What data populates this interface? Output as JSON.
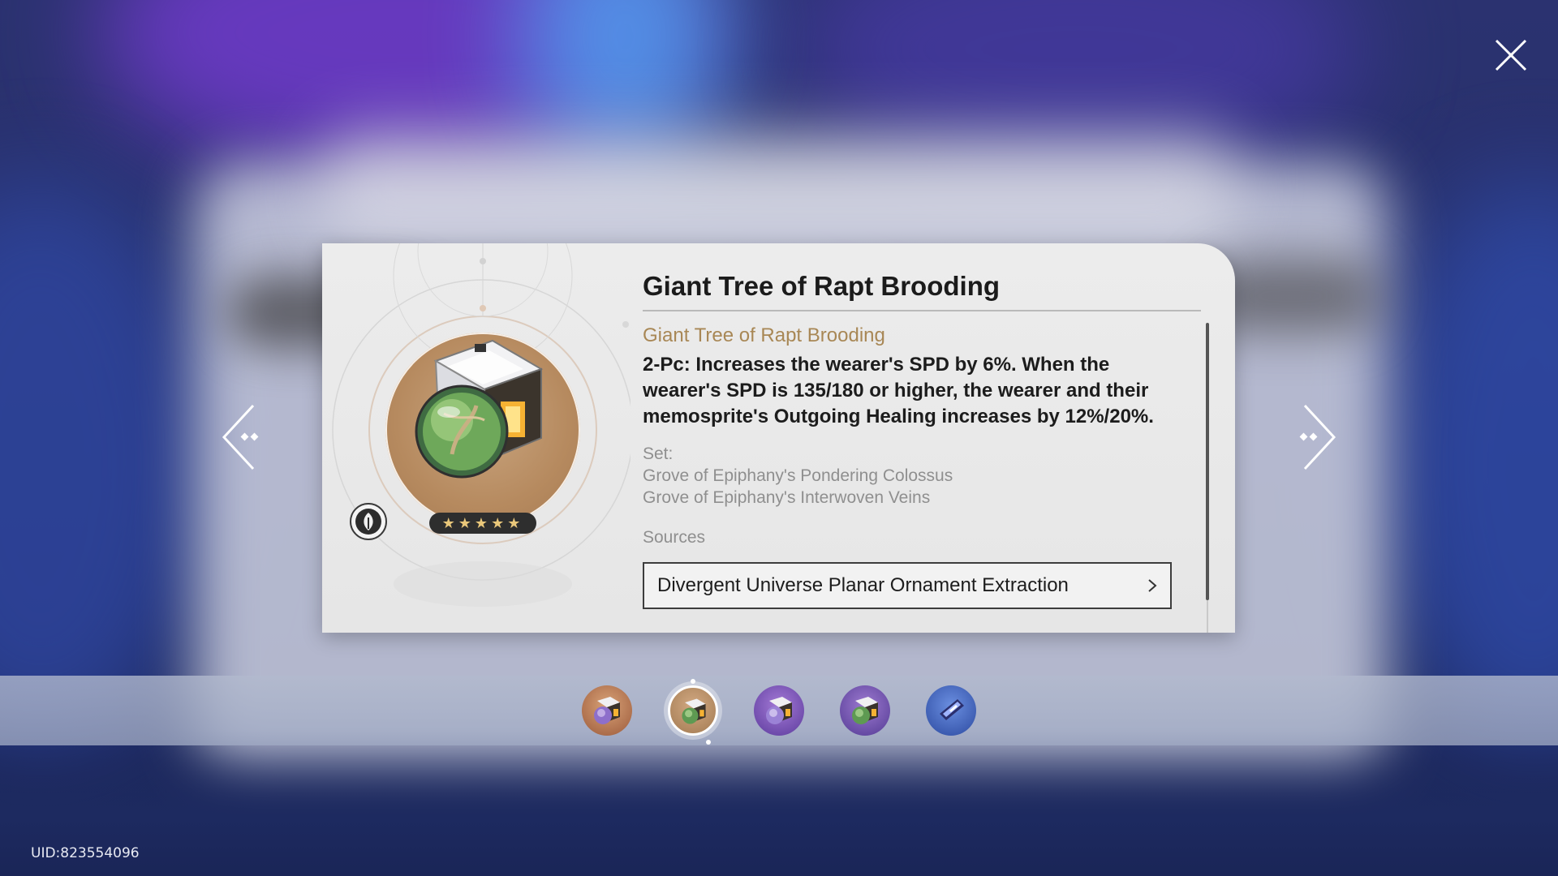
{
  "relic": {
    "title": "Giant Tree of Rapt Brooding",
    "set_name": "Giant Tree of Rapt Brooding",
    "effect": "2-Pc: Increases the wearer's SPD by 6%. When the wearer's SPD is 135/180 or higher, the wearer and their memosprite's Outgoing Healing increases by 12%/20%.",
    "set_label": "Set:",
    "set_items": [
      "Grove of Epiphany's Pondering Colossus",
      "Grove of Epiphany's Interwoven Veins"
    ],
    "rarity_stars": "★★★★★",
    "rarity": 5,
    "path_icon": "abundance-path-icon",
    "item_icon": "planar-ornament-icon"
  },
  "sources": {
    "label": "Sources",
    "items": [
      "Divergent Universe Planar Ornament Extraction"
    ]
  },
  "carousel": {
    "items": [
      "planar-ornament-1",
      "planar-ornament-2",
      "planar-ornament-3",
      "planar-ornament-4",
      "planar-ornament-5"
    ],
    "selected": 1
  },
  "footer": {
    "uid": "UID:823554096"
  },
  "colors": {
    "accent_gold": "#a88755",
    "card_bg": "#e8e8e8",
    "star_gold": "#e9c77a"
  }
}
